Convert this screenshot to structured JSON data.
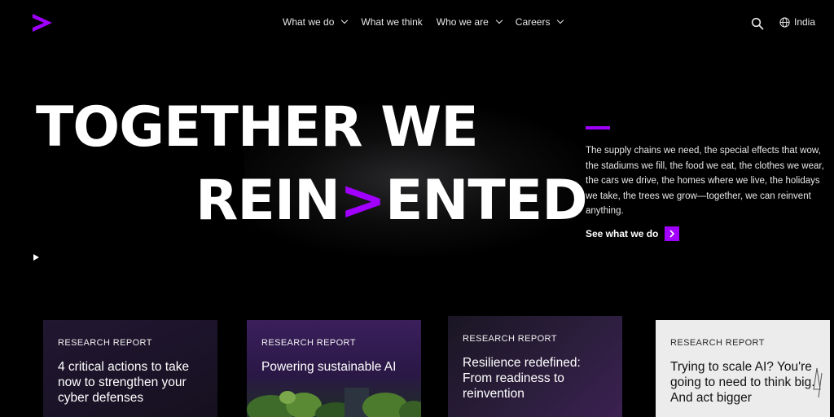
{
  "brand": {
    "accent": "#a100ff",
    "logo_icon": "accenture-chevron-icon"
  },
  "nav": {
    "items": [
      {
        "label": "What we do",
        "has_dropdown": true
      },
      {
        "label": "What we think",
        "has_dropdown": false
      },
      {
        "label": "Who we are",
        "has_dropdown": true
      },
      {
        "label": "Careers",
        "has_dropdown": true
      }
    ],
    "search_icon": "search-icon",
    "country": "India"
  },
  "hero": {
    "headline_line1": "TOGETHER WE",
    "headline_line2_pre": "REIN",
    "headline_line2_accent": ">",
    "headline_line2_post": "ENTED",
    "body": "The supply chains we need, the special effects that wow, the stadiums we fill, the food we eat, the clothes we wear, the cars we drive, the homes where we live, the holidays we take, the trees we grow—together, we can reinvent anything.",
    "cta": "See what we do"
  },
  "cards": [
    {
      "label": "RESEARCH REPORT",
      "title": "4 critical actions to take now to strengthen your cyber defenses"
    },
    {
      "label": "RESEARCH REPORT",
      "title": "Powering sustainable AI"
    },
    {
      "label": "RESEARCH REPORT",
      "title": "Resilience redefined: From readiness to reinvention"
    },
    {
      "label": "RESEARCH REPORT",
      "title": "Trying to scale AI? You're going to need to think big. And act bigger"
    }
  ]
}
